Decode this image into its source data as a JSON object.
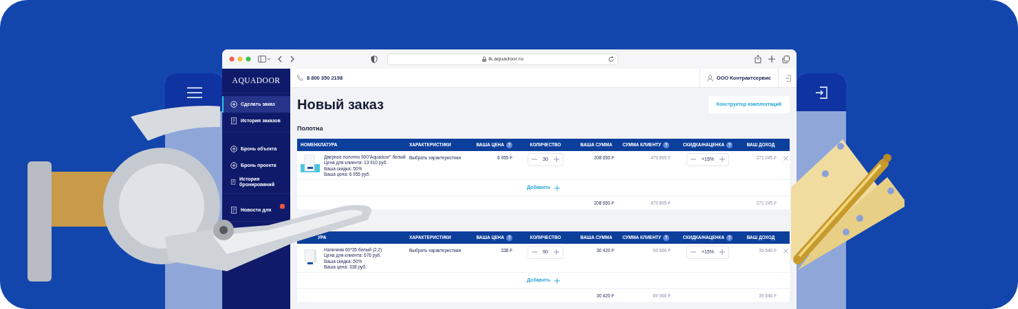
{
  "browser": {
    "url": "lk.aquadoor.ru"
  },
  "sidebar": {
    "logo": "AQUADOOR",
    "groups": [
      [
        {
          "label": "Сделать заказ",
          "kind": "plus",
          "selected": true,
          "has_badge": false
        },
        {
          "label": "История заказов",
          "kind": "doc",
          "selected": false,
          "has_badge": false
        }
      ],
      [
        {
          "label": "Бронь объекта",
          "kind": "plus",
          "selected": false,
          "has_badge": false
        },
        {
          "label": "Бронь проекта",
          "kind": "plus",
          "selected": false,
          "has_badge": false
        },
        {
          "label": "История бронирований",
          "kind": "doc",
          "selected": false,
          "has_badge": false
        }
      ],
      [
        {
          "label": "Новости для",
          "kind": "doc",
          "selected": false,
          "has_badge": true
        }
      ]
    ]
  },
  "header": {
    "phone": "8 800 350 2198",
    "company": "ООО Контрактсервис"
  },
  "page": {
    "title": "Новый заказ",
    "constructor_button": "Конструктор комплектаций"
  },
  "sections": [
    {
      "title": "Полотна",
      "columns": [
        {
          "label": "НОМЕНКЛАТУРА"
        },
        {
          "label": "ХАРАКТЕРИСТИКИ"
        },
        {
          "label": "ВАША ЦЕНА",
          "help_mark": "?"
        },
        {
          "label": "КОЛИЧЕСТВО"
        },
        {
          "label": "ВАША СУММА"
        },
        {
          "label": "СУММА КЛИЕНТУ",
          "help_mark": "?"
        },
        {
          "label": "СКИДКА/НАЦЕНКА",
          "help_mark": "?"
        },
        {
          "label": "ВАШ ДОХОД"
        }
      ],
      "rows": [
        {
          "kind": "door",
          "name": "Дверное полотно 900\"Aquadoor\" белый",
          "details": [
            "Цена для клиента: 13 910 руб.",
            "Ваша скидка: 50%",
            "Ваша цена: 6 955 руб."
          ],
          "options": "Выбрать характеристики",
          "price": "6 955 ₽",
          "quantity": "30",
          "sum": "208 650 ₽",
          "client_sum": "479 895 ₽",
          "markup": "+15%",
          "income": "271 245 ₽"
        }
      ],
      "add_label": "Добавить",
      "totals": {
        "sum": "208 650 ₽",
        "client_sum": "479 895 ₽",
        "income": "271 245 ₽"
      }
    },
    {
      "columns": [
        {
          "label": "УРА"
        },
        {
          "label": "ХАРАКТЕРИСТИКИ"
        },
        {
          "label": "ВАША ЦЕНА",
          "help_mark": "?"
        },
        {
          "label": "КОЛИЧЕСТВО"
        },
        {
          "label": "ВАША СУММА"
        },
        {
          "label": "СУММА КЛИЕНТУ",
          "help_mark": "?"
        },
        {
          "label": "СКИДКА/НАЦЕНКА",
          "help_mark": "?"
        },
        {
          "label": "ВАШ ДОХОД"
        }
      ],
      "rows": [
        {
          "kind": "trim",
          "name": "Наличник 60*35 белый (2,2)",
          "details": [
            "Цена для клиента: 676 руб.",
            "Ваша скидка: 50%",
            "Ваша цена: 338 руб."
          ],
          "options": "Выбрать характеристики",
          "price": "338 ₽",
          "quantity": "90",
          "sum": "30 420 ₽",
          "client_sum": "69 966 ₽",
          "markup": "+15%",
          "income": "39 546 ₽"
        }
      ],
      "add_label": "Добавить",
      "totals": {
        "sum": "30 420 ₽",
        "client_sum": "69 966 ₽",
        "income": "39 546 ₽"
      }
    }
  ]
}
